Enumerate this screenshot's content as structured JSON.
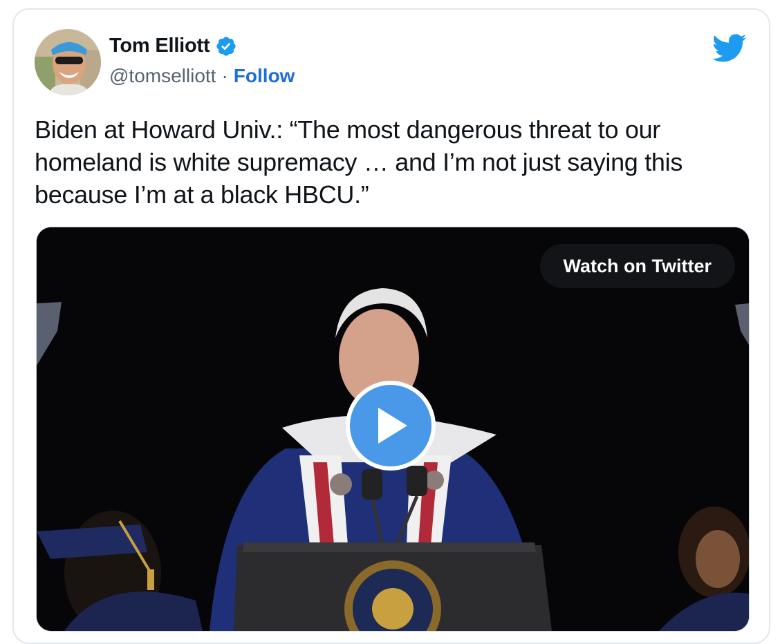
{
  "author": {
    "display_name": "Tom Elliott",
    "handle": "@tomselliott",
    "separator": "·",
    "follow_label": "Follow"
  },
  "tweet": {
    "text": "Biden at Howard Univ.: “The most dangerous threat to our homeland is white supremacy … and I’m not just saying this because I’m at a black HBCU.”"
  },
  "media": {
    "watch_label": "Watch on Twitter"
  },
  "icons": {
    "verified": "verified-badge-icon",
    "brand": "twitter-bird-icon",
    "play": "play-icon"
  },
  "colors": {
    "verified_blue": "#1d9bf0",
    "follow_blue": "#1d6fd6",
    "twitter_blue": "#1d9bf0",
    "play_button": "#4a99e9"
  }
}
